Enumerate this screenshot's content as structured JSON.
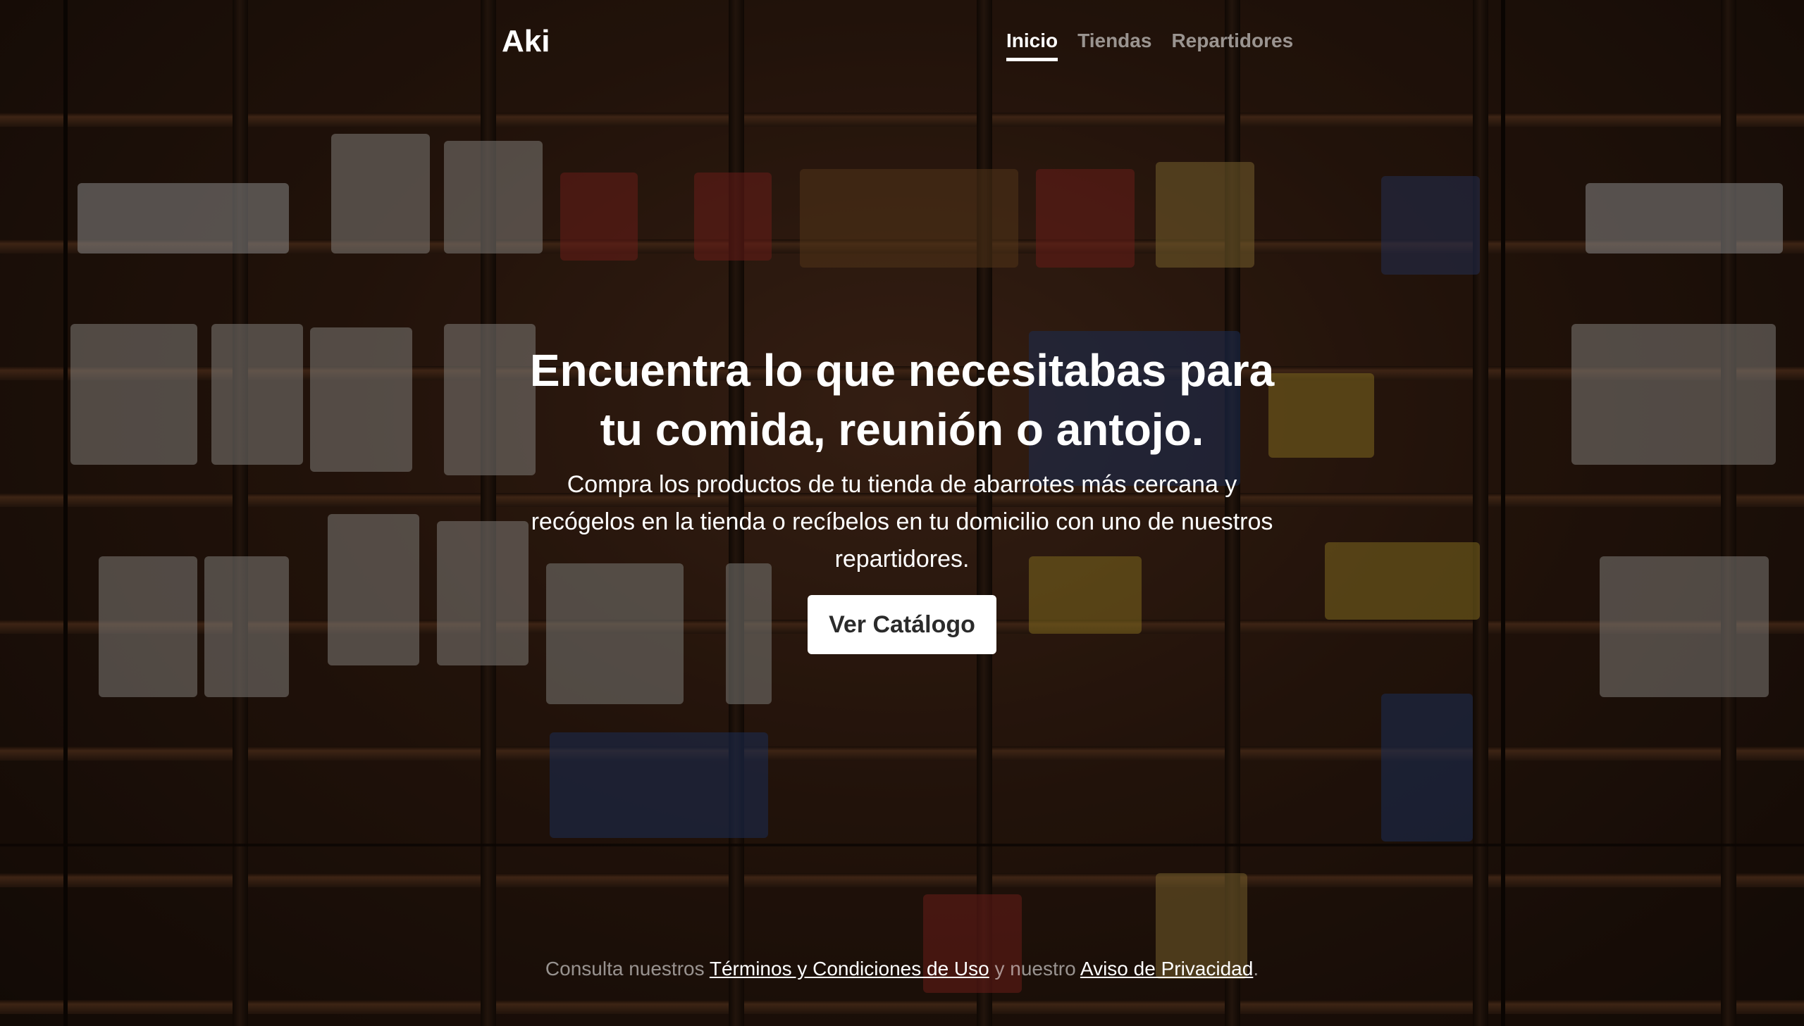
{
  "header": {
    "brand": "Aki",
    "nav": [
      {
        "label": "Inicio",
        "active": true
      },
      {
        "label": "Tiendas",
        "active": false
      },
      {
        "label": "Repartidores",
        "active": false
      }
    ]
  },
  "hero": {
    "title": "Encuentra lo que necesitabas para tu comida, reunión o antojo.",
    "lead": "Compra los productos de tu tienda de abarrotes más cercana y recógelos en la tienda o recíbelos en tu domicilio con uno de nuestros repartidores.",
    "cta_label": "Ver Catálogo"
  },
  "footer": {
    "prefix": "Consulta nuestros ",
    "terms_link": "Términos y Condiciones de Uso",
    "middle": " y nuestro ",
    "privacy_link": "Aviso de Privacidad",
    "suffix": "."
  },
  "colors": {
    "text": "#ffffff",
    "muted_text": "rgba(255,255,255,0.55)",
    "button_bg": "#ffffff",
    "button_text": "#2b2b2b",
    "overlay": "rgba(0,0,0,0.42)"
  }
}
